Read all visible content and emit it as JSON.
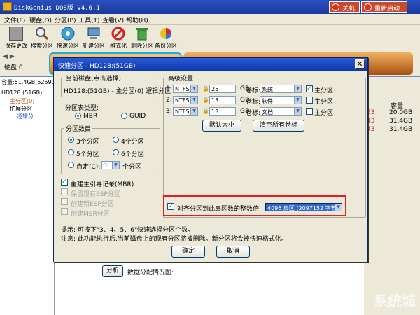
{
  "app": {
    "title": "DiskGenius DOS版 V4.6.1",
    "shutdown": "关机",
    "restart": "重新启动"
  },
  "menu": [
    "文件(F)",
    "硬盘(D)",
    "分区(P)",
    "工具(T)",
    "查看(V)",
    "帮助(H)"
  ],
  "toolbar": [
    {
      "label": "保存更改",
      "icon": "save-icon"
    },
    {
      "label": "搜索分区",
      "icon": "magnifier-icon"
    },
    {
      "label": "快速分区",
      "icon": "disk-icon"
    },
    {
      "label": "新建分区",
      "icon": "computer-icon"
    },
    {
      "label": "格式化",
      "icon": "format-icon"
    },
    {
      "label": "删除分区",
      "icon": "trash-icon"
    },
    {
      "label": "备份分区",
      "icon": "backup-icon"
    }
  ],
  "diskbar": {
    "nav": "◀ ▶",
    "disk": "硬盘 0"
  },
  "left": {
    "capacity": "容量:51.4GB(52590M",
    "tree": [
      "HD128:(51GB)",
      "主分区(0)",
      "扩展分区",
      "逻辑分"
    ]
  },
  "right": {
    "col_capacity": "容量",
    "rows": [
      {
        "n": "53",
        "v": "20.0GB"
      },
      {
        "n": "43",
        "v": "31.4GB"
      },
      {
        "n": "43",
        "v": "31.4GB"
      }
    ]
  },
  "dialog": {
    "title": "快速分区 - HD128:(51GB)",
    "current_disk_label": "当前磁盘(点击选择)",
    "current_disk_value": "HD128:(51GB) - 主分区(0) 逻辑分区",
    "table_type_label": "分区表类型:",
    "table_type_options": [
      "MBR",
      "GUID"
    ],
    "count_label": "分区数目",
    "count_options": [
      "3个分区",
      "4个分区",
      "5个分区",
      "6个分区",
      "自定(C):"
    ],
    "custom_value": "3",
    "custom_unit": "个分区",
    "checks": [
      {
        "label": "重建主引导记录(MBR)",
        "checked": true,
        "disabled": false
      },
      {
        "label": "保留现有ESP分区",
        "checked": false,
        "disabled": true
      },
      {
        "label": "创建新ESP分区",
        "checked": false,
        "disabled": true
      },
      {
        "label": "创建MSR分区",
        "checked": false,
        "disabled": true
      }
    ],
    "advanced_label": "高级设置",
    "partitions": [
      {
        "num": "1:",
        "fs": "NTFS",
        "size": "25",
        "unit": "GB",
        "vol_label": "卷标:",
        "vol": "系统",
        "primary": true
      },
      {
        "num": "2:",
        "fs": "NTFS",
        "size": "13",
        "unit": "GB",
        "vol_label": "卷标:",
        "vol": "软件",
        "primary": false
      },
      {
        "num": "3:",
        "fs": "NTFS",
        "size": "13",
        "unit": "GB",
        "vol_label": "卷标:",
        "vol": "文档",
        "primary": false
      }
    ],
    "primary_label": "主分区",
    "default_size_btn": "默认大小",
    "clear_labels_btn": "清空所有卷标",
    "align_label": "对齐分区到此扇区数的整数倍:",
    "align_value": "4096 扇区 (2097152 字节)",
    "tip1": "提示: 可按下\"3、4、5、6\"快速选择分区个数。",
    "tip2": "注意: 此功能执行后,当前磁盘上的现有分区将被删除。新分区将会被快速格式化。",
    "ok": "确定",
    "cancel": "取消"
  },
  "bottom": {
    "analyze": "分析",
    "distribution": "数据分配情况图:"
  },
  "watermark": "系统城",
  "colors": {
    "highlight": "#e02020",
    "select_bg": "#316ac5"
  }
}
